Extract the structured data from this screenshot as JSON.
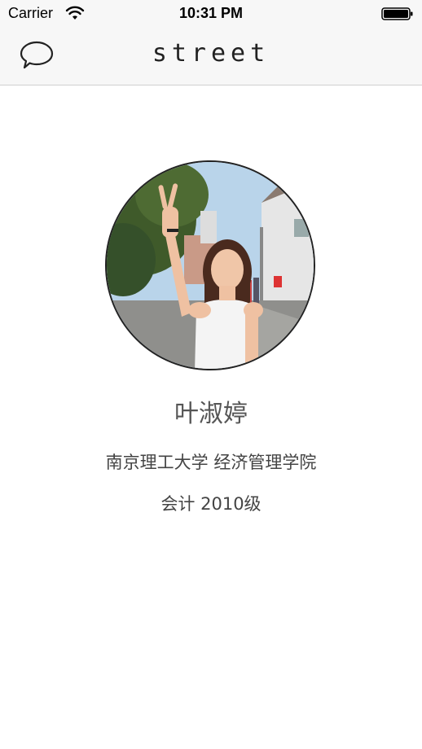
{
  "status_bar": {
    "carrier": "Carrier",
    "time": "10:31 PM",
    "wifi_icon": "wifi-icon",
    "battery_icon": "battery-full-icon"
  },
  "nav_bar": {
    "title": "street",
    "left_icon": "chat-bubble-icon"
  },
  "profile": {
    "name": "叶淑婷",
    "school": "南京理工大学 经济管理学院",
    "major": "会计 2010级",
    "avatar_image": "profile-photo"
  },
  "colors": {
    "background": "#ffffff",
    "bar_background": "#f7f7f7",
    "text_primary": "#222222",
    "text_secondary": "#444444"
  }
}
